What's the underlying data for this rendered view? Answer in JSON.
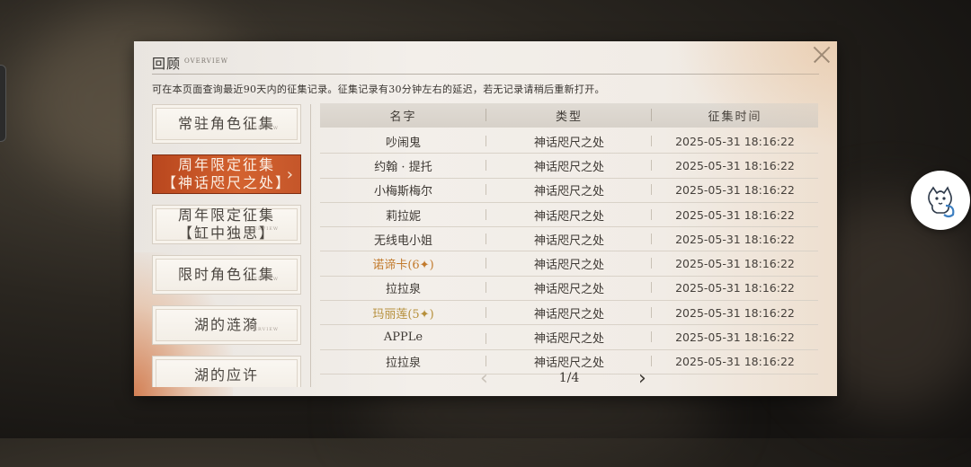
{
  "dialog": {
    "title": "回顾",
    "title_en": "OVERVIEW",
    "notice": "可在本页面查询最近90天内的征集记录。征集记录有30分钟左右的延迟，若无记录请稍后重新打开。"
  },
  "categories": [
    {
      "line1": "常驻角色征集",
      "line2": "",
      "mini": "OVERVIEW",
      "active": false
    },
    {
      "line1": "周年限定征集",
      "line2": "【神话咫尺之处】",
      "mini": "",
      "active": true
    },
    {
      "line1": "周年限定征集",
      "line2": "【缸中独思】",
      "mini": "OVERVIEW",
      "active": false
    },
    {
      "line1": "限时角色征集",
      "line2": "",
      "mini": "OVERVIEW",
      "active": false
    },
    {
      "line1": "湖的涟漪",
      "line2": "",
      "mini": "OVERVIEW",
      "active": false
    },
    {
      "line1": "湖的应许",
      "line2": "",
      "mini": "",
      "active": false
    }
  ],
  "table": {
    "headers": [
      "名字",
      "类型",
      "征集时间"
    ],
    "rows": [
      {
        "name": "吵闹鬼",
        "type": "神话咫尺之处",
        "time": "2025-05-31 18:16:22",
        "rarity": "normal"
      },
      {
        "name": "约翰 · 提托",
        "type": "神话咫尺之处",
        "time": "2025-05-31 18:16:22",
        "rarity": "normal"
      },
      {
        "name": "小梅斯梅尔",
        "type": "神话咫尺之处",
        "time": "2025-05-31 18:16:22",
        "rarity": "normal"
      },
      {
        "name": "莉拉妮",
        "type": "神话咫尺之处",
        "time": "2025-05-31 18:16:22",
        "rarity": "normal"
      },
      {
        "name": "无线电小姐",
        "type": "神话咫尺之处",
        "time": "2025-05-31 18:16:22",
        "rarity": "normal"
      },
      {
        "name": "诺谛卡(6✦)",
        "type": "神话咫尺之处",
        "time": "2025-05-31 18:16:22",
        "rarity": "six"
      },
      {
        "name": "拉拉泉",
        "type": "神话咫尺之处",
        "time": "2025-05-31 18:16:22",
        "rarity": "normal"
      },
      {
        "name": "玛丽莲(5✦)",
        "type": "神话咫尺之处",
        "time": "2025-05-31 18:16:22",
        "rarity": "five"
      },
      {
        "name": "APPLe",
        "type": "神话咫尺之处",
        "time": "2025-05-31 18:16:22",
        "rarity": "normal"
      },
      {
        "name": "拉拉泉",
        "type": "神话咫尺之处",
        "time": "2025-05-31 18:16:22",
        "rarity": "normal"
      }
    ]
  },
  "pager": {
    "text": "1/4",
    "prev_icon": "chevron-left-icon",
    "next_icon": "chevron-right-icon"
  },
  "floating": {
    "icon": "mascot-icon"
  },
  "colors": {
    "active_tab": "#c9552a",
    "six_star": "#c27a2c",
    "five_star": "#b68f3a"
  }
}
